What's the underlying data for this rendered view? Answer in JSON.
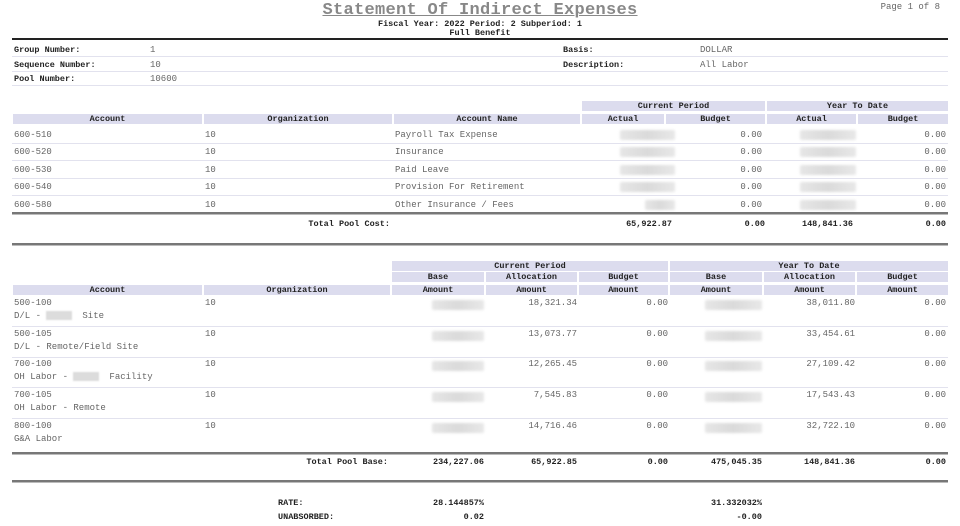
{
  "report": {
    "title": "Statement Of Indirect Expenses",
    "subtitle": "Fiscal Year: 2022  Period: 2  Subperiod: 1",
    "subtitle2": "Full Benefit",
    "page": "Page 1 of 8"
  },
  "info": {
    "group_number_label": "Group Number:",
    "group_number": "1",
    "sequence_number_label": "Sequence Number:",
    "sequence_number": "10",
    "pool_number_label": "Pool Number:",
    "pool_number": "10600",
    "basis_label": "Basis:",
    "basis": "DOLLAR",
    "description_label": "Description:",
    "description": "All Labor"
  },
  "cost_table": {
    "group_headers": [
      "Current Period",
      "Year To Date"
    ],
    "headers": [
      "Account",
      "Organization",
      "Account Name",
      "Actual",
      "Budget",
      "Actual",
      "Budget"
    ],
    "rows": [
      {
        "account": "600-510",
        "org": "10",
        "name": "Payroll Tax Expense",
        "cp_actual": "[redacted]",
        "cp_budget": "0.00",
        "ytd_actual": "[redacted]",
        "ytd_budget": "0.00"
      },
      {
        "account": "600-520",
        "org": "10",
        "name": "Insurance",
        "cp_actual": "[redacted]",
        "cp_budget": "0.00",
        "ytd_actual": "[redacted]",
        "ytd_budget": "0.00"
      },
      {
        "account": "600-530",
        "org": "10",
        "name": "Paid Leave",
        "cp_actual": "[redacted]",
        "cp_budget": "0.00",
        "ytd_actual": "[redacted]",
        "ytd_budget": "0.00"
      },
      {
        "account": "600-540",
        "org": "10",
        "name": "Provision For Retirement",
        "cp_actual": "[redacted]",
        "cp_budget": "0.00",
        "ytd_actual": "[redacted]",
        "ytd_budget": "0.00"
      },
      {
        "account": "600-580",
        "org": "10",
        "name": "Other Insurance / Fees",
        "cp_actual": "[redacted]",
        "cp_budget": "0.00",
        "ytd_actual": "[redacted]",
        "ytd_budget": "0.00"
      }
    ],
    "total_label": "Total Pool Cost:",
    "total": {
      "cp_actual": "65,922.87",
      "cp_budget": "0.00",
      "ytd_actual": "148,841.36",
      "ytd_budget": "0.00"
    }
  },
  "base_table": {
    "group_headers": [
      "Current Period",
      "Year To Date"
    ],
    "sub_headers": [
      "Base",
      "Allocation",
      "Budget",
      "Base",
      "Allocation",
      "Budget"
    ],
    "headers": [
      "Account",
      "Organization",
      "Amount",
      "Amount",
      "Amount",
      "Amount",
      "Amount",
      "Amount"
    ],
    "rows": [
      {
        "account": "500-100",
        "desc_prefix": "D/L - ",
        "desc_suffix": "Site",
        "redacted_desc": true,
        "org": "10",
        "cp_base": "[redacted]",
        "cp_alloc": "18,321.34",
        "cp_budget": "0.00",
        "ytd_base": "[redacted]",
        "ytd_alloc": "38,011.80",
        "ytd_budget": "0.00"
      },
      {
        "account": "500-105",
        "desc_prefix": "D/L - Remote/Field Site",
        "desc_suffix": "",
        "redacted_desc": false,
        "org": "10",
        "cp_base": "[redacted]",
        "cp_alloc": "13,073.77",
        "cp_budget": "0.00",
        "ytd_base": "[redacted]",
        "ytd_alloc": "33,454.61",
        "ytd_budget": "0.00"
      },
      {
        "account": "700-100",
        "desc_prefix": "OH Labor - ",
        "desc_suffix": "Facility",
        "redacted_desc": true,
        "org": "10",
        "cp_base": "[redacted]",
        "cp_alloc": "12,265.45",
        "cp_budget": "0.00",
        "ytd_base": "[redacted]",
        "ytd_alloc": "27,109.42",
        "ytd_budget": "0.00"
      },
      {
        "account": "700-105",
        "desc_prefix": "OH Labor - Remote",
        "desc_suffix": "",
        "redacted_desc": false,
        "org": "10",
        "cp_base": "[redacted]",
        "cp_alloc": "7,545.83",
        "cp_budget": "0.00",
        "ytd_base": "[redacted]",
        "ytd_alloc": "17,543.43",
        "ytd_budget": "0.00"
      },
      {
        "account": "800-100",
        "desc_prefix": "G&A Labor",
        "desc_suffix": "",
        "redacted_desc": false,
        "org": "10",
        "cp_base": "[redacted]",
        "cp_alloc": "14,716.46",
        "cp_budget": "0.00",
        "ytd_base": "[redacted]",
        "ytd_alloc": "32,722.10",
        "ytd_budget": "0.00"
      }
    ],
    "total_label": "Total Pool Base:",
    "total": {
      "cp_base": "234,227.06",
      "cp_alloc": "65,922.85",
      "cp_budget": "0.00",
      "ytd_base": "475,045.35",
      "ytd_alloc": "148,841.36",
      "ytd_budget": "0.00"
    }
  },
  "summary": {
    "rate_label": "RATE:",
    "rate_cp": "28.144857%",
    "rate_ytd": "31.332032%",
    "unabsorbed_label": "UNABSORBED:",
    "unabsorbed_cp": "0.02",
    "unabsorbed_ytd": "-0.00"
  }
}
